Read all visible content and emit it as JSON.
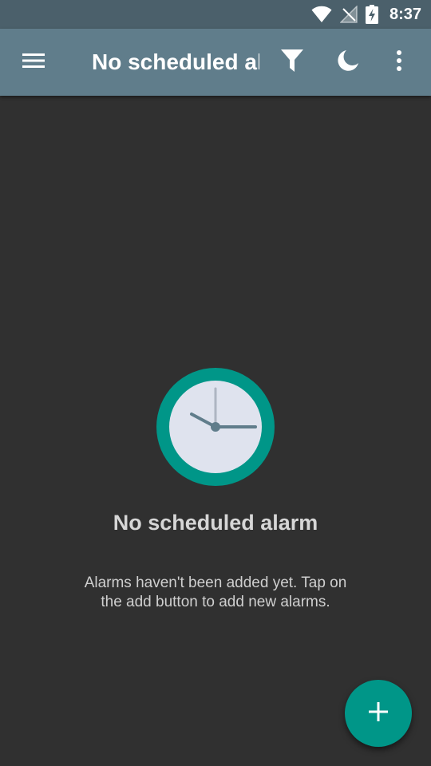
{
  "status_bar": {
    "time": "8:37",
    "icons": [
      "wifi-icon",
      "no-signal-icon",
      "battery-charging-icon"
    ]
  },
  "app_bar": {
    "title": "No scheduled alarm",
    "actions": [
      "menu-icon",
      "filter-icon",
      "moon-icon",
      "more-vert-icon"
    ],
    "colors": {
      "background": "#607d8b",
      "status_bar": "#4b606b"
    }
  },
  "empty_state": {
    "icon": "clock-icon",
    "title": "No scheduled alarm",
    "description": "Alarms haven't been added yet. Tap on the add button to add new alarms."
  },
  "fab": {
    "icon": "plus-icon",
    "color": "#009688"
  },
  "theme": {
    "background": "#303030",
    "accent": "#009688"
  }
}
